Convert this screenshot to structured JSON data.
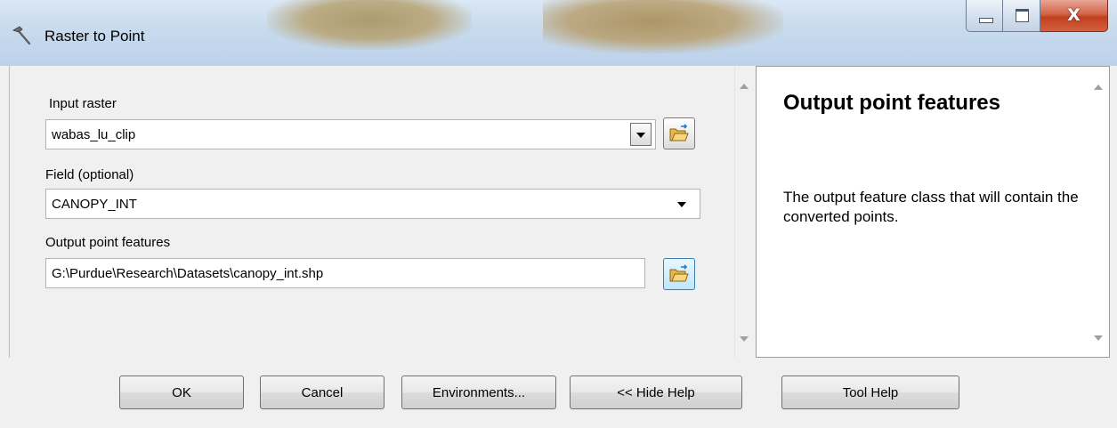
{
  "window": {
    "title": "Raster to Point",
    "close_glyph": "X"
  },
  "params": {
    "input_raster": {
      "label": "Input raster",
      "value": "wabas_lu_clip"
    },
    "field": {
      "label": "Field (optional)",
      "value": "CANOPY_INT"
    },
    "output": {
      "label": "Output point features",
      "value": "G:\\Purdue\\Research\\Datasets\\canopy_int.shp"
    }
  },
  "help": {
    "title": "Output point features",
    "body": "The output feature class that will contain the converted points."
  },
  "buttons": {
    "ok": "OK",
    "cancel": "Cancel",
    "environments": "Environments...",
    "hide_help": "<< Hide Help",
    "tool_help": "Tool Help"
  },
  "icons": {
    "title": "hammer-icon",
    "browse": "open-folder-icon"
  }
}
